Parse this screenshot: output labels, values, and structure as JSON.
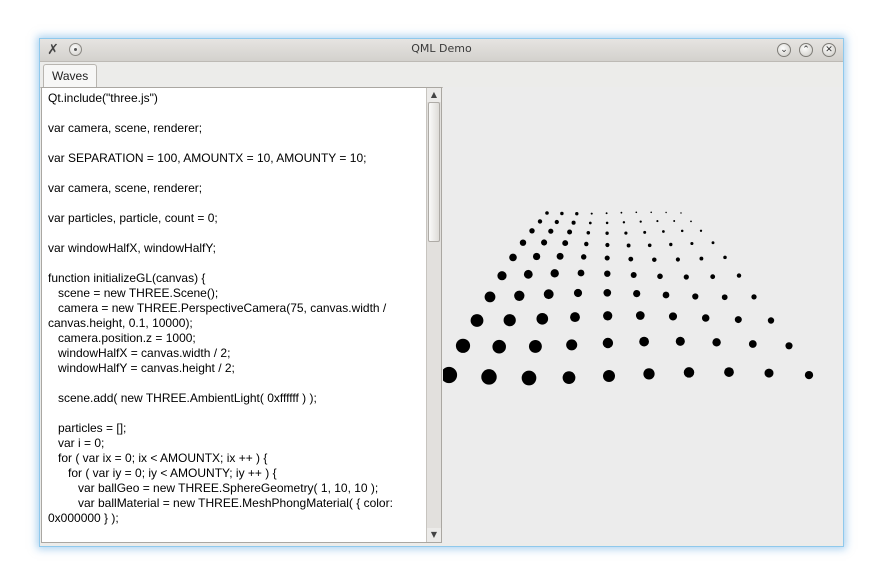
{
  "window": {
    "title": "QML Demo",
    "minimize_glyph": "⌄",
    "maximize_glyph": "⌃",
    "close_glyph": "✕",
    "app_icon_glyph": "✗"
  },
  "tabs": [
    {
      "label": "Waves",
      "selected": true
    }
  ],
  "editor": {
    "lines": [
      "Qt.include(\"three.js\")",
      "",
      "var camera, scene, renderer;",
      "",
      "var SEPARATION = 100, AMOUNTX = 10, AMOUNTY = 10;",
      "",
      "var camera, scene, renderer;",
      "",
      "var particles, particle, count = 0;",
      "",
      "var windowHalfX, windowHalfY;",
      "",
      "function initializeGL(canvas) {",
      "   scene = new THREE.Scene();",
      "   camera = new THREE.PerspectiveCamera(75, canvas.width /",
      "canvas.height, 0.1, 10000);",
      "   camera.position.z = 1000;",
      "   windowHalfX = canvas.width / 2;",
      "   windowHalfY = canvas.height / 2;",
      "",
      "   scene.add( new THREE.AmbientLight( 0xffffff ) );",
      "",
      "   particles = [];",
      "   var i = 0;",
      "   for ( var ix = 0; ix < AMOUNTX; ix ++ ) {",
      "      for ( var iy = 0; iy < AMOUNTY; iy ++ ) {",
      "         var ballGeo = new THREE.SphereGeometry( 1, 10, 10 );",
      "         var ballMaterial = new THREE.MeshPhongMaterial( { color:",
      "0x000000 } );"
    ]
  },
  "scene": {
    "background": "#ececec",
    "dot_color": "#000000"
  },
  "colors": {
    "window_border_glow": "#8fc9ec",
    "titlebar": "#dcdad6"
  }
}
